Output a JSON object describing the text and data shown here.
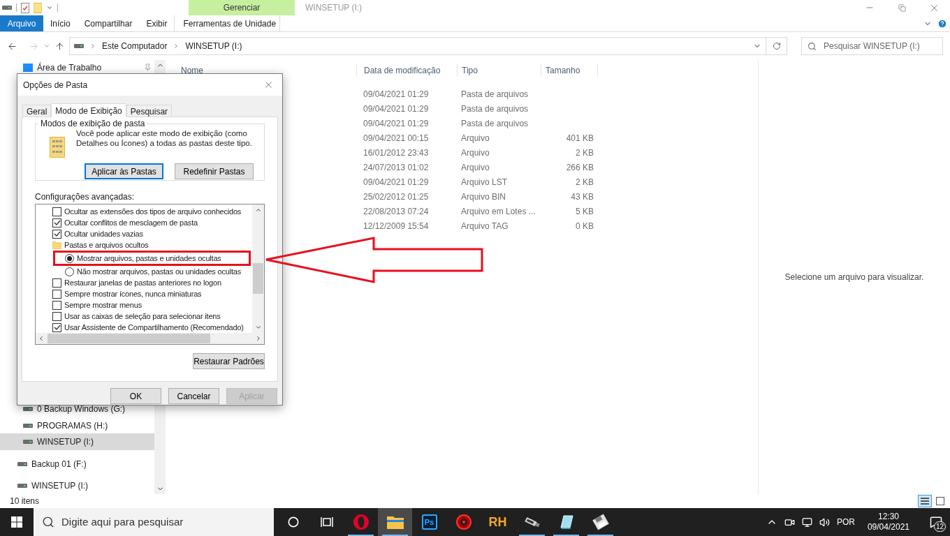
{
  "window": {
    "title": "WINSETUP (I:)",
    "context_group": "Gerenciar"
  },
  "ribbon_tabs": [
    {
      "label": "Arquivo",
      "kind": "file"
    },
    {
      "label": "Início",
      "kind": "tab"
    },
    {
      "label": "Compartilhar",
      "kind": "tab"
    },
    {
      "label": "Exibir",
      "kind": "tab"
    },
    {
      "label": "Ferramentas de Unidade",
      "kind": "context"
    }
  ],
  "address": {
    "path": [
      "Este Computador",
      "WINSETUP (I:)"
    ]
  },
  "search": {
    "placeholder": "Pesquisar WINSETUP (I:)"
  },
  "nav_pane": {
    "top": [
      {
        "label": "Área de Trabalho",
        "pinned": true,
        "selected": false
      }
    ],
    "drives": [
      {
        "label": "0 Backup Windows (G:)",
        "selected": false
      },
      {
        "label": "PROGRAMAS (H:)",
        "selected": false
      },
      {
        "label": "WINSETUP (I:)",
        "selected": true
      }
    ],
    "items": [
      {
        "label": "Backup 01 (F:)",
        "selected": false
      },
      {
        "label": "WINSETUP (I:)",
        "selected": false
      }
    ]
  },
  "file_list": {
    "columns": [
      "Nome",
      "Data de modificação",
      "Tipo",
      "Tamanho"
    ],
    "rows": [
      {
        "date": "09/04/2021 01:29",
        "type": "Pasta de arquivos"
      },
      {
        "date": "09/04/2021 01:29",
        "type": "Pasta de arquivos"
      },
      {
        "date": "09/04/2021 01:29",
        "type": "Pasta de arquivos"
      },
      {
        "date": "09/04/2021 00:15",
        "type": "Arquivo",
        "size": "401 KB"
      },
      {
        "date": "16/01/2012 23:43",
        "type": "Arquivo",
        "size": "2 KB"
      },
      {
        "date": "24/07/2013 01:02",
        "type": "Arquivo",
        "size": "266 KB"
      },
      {
        "date": "09/04/2021 01:29",
        "type": "Arquivo LST",
        "size": "2 KB"
      },
      {
        "date": "25/02/2012 01:25",
        "type": "Arquivo BIN",
        "size": "43 KB"
      },
      {
        "date": "22/08/2013 07:24",
        "type": "Arquivo em Lotes ...",
        "size": "5 KB"
      },
      {
        "date": "12/12/2009 15:54",
        "type": "Arquivo TAG",
        "size": "0 KB"
      }
    ]
  },
  "preview": {
    "text": "Selecione um arquivo para visualizar."
  },
  "status_bar": {
    "count": "10 itens"
  },
  "dialog": {
    "title": "Opções de Pasta",
    "tabs": [
      {
        "label": "Geral",
        "selected": false
      },
      {
        "label": "Modo de Exibição",
        "selected": true
      },
      {
        "label": "Pesquisar",
        "selected": false
      }
    ],
    "group": {
      "title": "Modos de exibição de pasta",
      "text": "Você pode aplicar este modo de exibição (como Detalhes ou Ícones) a todas as pastas deste tipo.",
      "buttons": [
        {
          "label": "Aplicar às Pastas",
          "default": true
        },
        {
          "label": "Redefinir Pastas",
          "default": false
        }
      ]
    },
    "advanced_label": "Configurações avançadas:",
    "advanced": [
      {
        "kind": "checkbox",
        "label": "Ocultar as extensões dos tipos de arquivo conhecidos",
        "checked": false
      },
      {
        "kind": "checkbox",
        "label": "Ocultar conflitos de mesclagem de pasta",
        "checked": true
      },
      {
        "kind": "checkbox",
        "label": "Ocultar unidades vazias",
        "checked": true
      },
      {
        "kind": "folder",
        "label": "Pastas e arquivos ocultos",
        "children": [
          {
            "kind": "radio",
            "label": "Mostrar arquivos, pastas e unidades ocultas",
            "selected": true,
            "highlighted": true
          },
          {
            "kind": "radio",
            "label": "Não mostrar arquivos, pastas ou unidades ocultas",
            "selected": false,
            "highlighted": false
          }
        ]
      },
      {
        "kind": "checkbox",
        "label": "Restaurar janelas de pastas anteriores no logon",
        "checked": false
      },
      {
        "kind": "checkbox",
        "label": "Sempre mostrar ícones, nunca miniaturas",
        "checked": false
      },
      {
        "kind": "checkbox",
        "label": "Sempre mostrar menus",
        "checked": false
      },
      {
        "kind": "checkbox",
        "label": "Usar as caixas de seleção para selecionar itens",
        "checked": false
      },
      {
        "kind": "checkbox",
        "label": "Usar Assistente de Compartilhamento (Recomendado)",
        "checked": true
      }
    ],
    "restore_button": "Restaurar Padrões",
    "footer_buttons": [
      {
        "label": "OK",
        "disabled": false
      },
      {
        "label": "Cancelar",
        "disabled": false
      },
      {
        "label": "Aplicar",
        "disabled": true
      }
    ]
  },
  "taskbar": {
    "search_placeholder": "Digite aqui para pesquisar",
    "apps": [
      {
        "kind": "opera",
        "running": true,
        "active": false
      },
      {
        "kind": "explorer",
        "running": true,
        "active": true
      },
      {
        "kind": "ps",
        "label": "Ps",
        "running": false,
        "active": false
      },
      {
        "kind": "game",
        "running": false,
        "active": false
      },
      {
        "kind": "rh",
        "label": "RH",
        "running": false,
        "active": false
      },
      {
        "kind": "usb",
        "running": true,
        "active": false
      },
      {
        "kind": "notepad",
        "running": true,
        "active": false
      },
      {
        "kind": "floppy",
        "running": true,
        "active": false
      }
    ],
    "language": "POR",
    "time": "12:30",
    "date": "09/04/2021",
    "notifications": "12"
  }
}
